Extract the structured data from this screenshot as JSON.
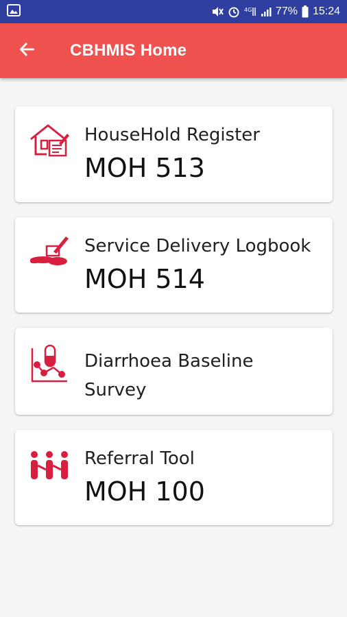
{
  "status_bar": {
    "battery_percent": "77%",
    "time": "15:24",
    "icons": [
      "image-icon",
      "mute-icon",
      "alarm-icon",
      "4g-icon",
      "signal-icon",
      "battery-icon"
    ]
  },
  "app_bar": {
    "title": "CBHMIS Home",
    "back_icon": "arrow-back-icon"
  },
  "colors": {
    "status_bar": "#2f3f9f",
    "app_bar": "#f0534f",
    "icon_accent": "#d81f3f"
  },
  "cards": [
    {
      "title": "HouseHold Register",
      "code": "MOH 513",
      "icon": "house-register-icon"
    },
    {
      "title": "Service Delivery Logbook",
      "code": "MOH 514",
      "icon": "hand-delivery-icon"
    },
    {
      "title": "Diarrhoea Baseline Survey",
      "code": "",
      "icon": "capsule-chart-icon"
    },
    {
      "title": "Referral Tool",
      "code": "MOH 100",
      "icon": "people-referral-icon"
    }
  ]
}
